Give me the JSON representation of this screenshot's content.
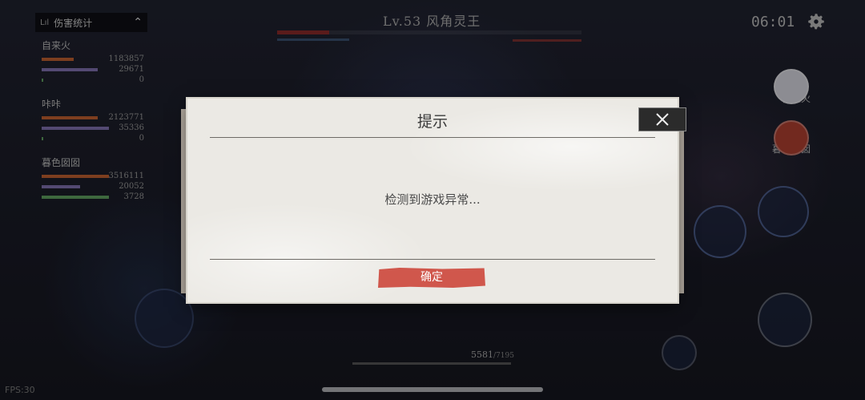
{
  "damage_panel": {
    "title": "伤害统计",
    "players": [
      {
        "name": "自来火",
        "values": [
          "1183857",
          "29671",
          "0"
        ]
      },
      {
        "name": "咔咔",
        "values": [
          "2123771",
          "35336",
          "0"
        ]
      },
      {
        "name": "暮色囡囡",
        "values": [
          "3516111",
          "20052",
          "3728"
        ]
      }
    ]
  },
  "boss": {
    "title": "Lv.53  风角灵王",
    "hp_fraction": 0.17
  },
  "timer": "06:01",
  "party": [
    "自来火",
    "暮色囡囡"
  ],
  "hp": {
    "current": "5581",
    "max": "/7195"
  },
  "fps": "FPS:30",
  "dialog": {
    "title": "提示",
    "message": "检测到游戏异常...",
    "confirm": "确定"
  },
  "colors": {
    "accent": "#d0574c",
    "dialog_bg": "#ebe9e4"
  }
}
